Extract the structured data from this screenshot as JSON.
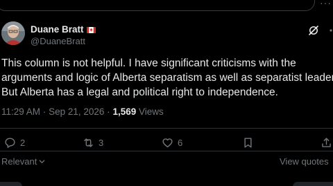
{
  "author": {
    "display_name": "Duane Bratt",
    "handle": "@DuaneBratt",
    "flag_icon": "canada-flag-icon"
  },
  "post": {
    "lines": [
      "This column is not helpful. I have significant criticisms with the",
      "arguments and logic of Alberta separatism as well as separatist leaders.",
      "But Alberta has a legal and political right to independence."
    ],
    "time": "11:29 AM",
    "separator": "·",
    "date": "Sep 21, 2026",
    "views_count": "1,569",
    "views_label": "Views"
  },
  "actions": {
    "replies": "2",
    "reposts": "3",
    "likes": "6"
  },
  "sort": {
    "label": "Relevant",
    "chevron": "chevron-down-icon"
  },
  "view_quotes_label": "View quotes",
  "colors": {
    "background": "#000000",
    "text_primary": "#e7e9ea",
    "text_secondary": "#71767b",
    "divider": "#2f3336"
  }
}
